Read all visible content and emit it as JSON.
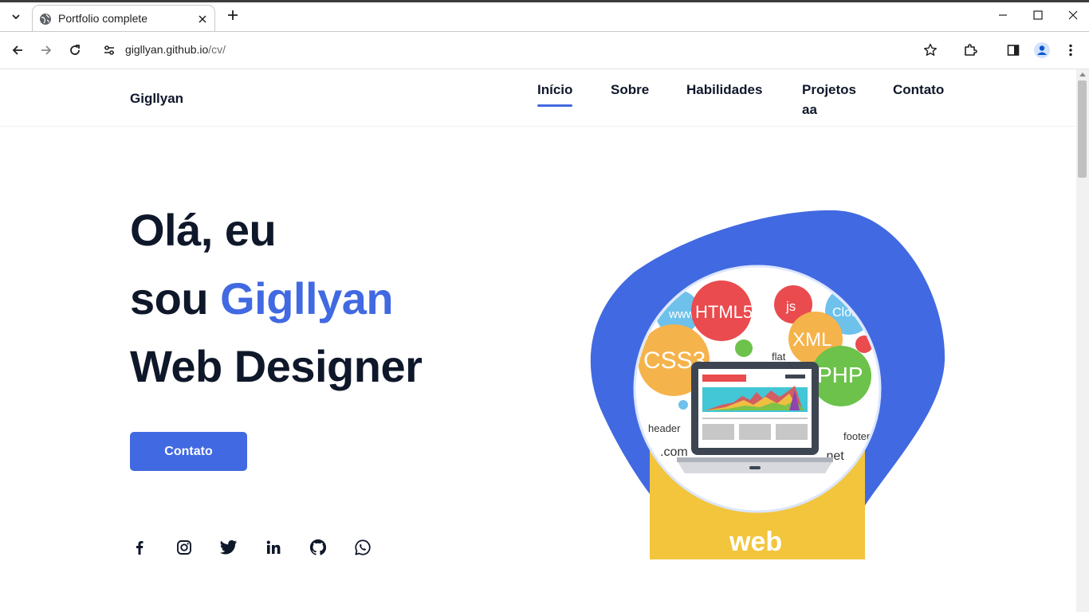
{
  "browser": {
    "tab_title": "Portfolio complete",
    "url_host": "gigllyan.github.io",
    "url_path": "/cv/"
  },
  "site": {
    "logo": "Gigllyan",
    "nav": [
      {
        "label": "Início",
        "active": true
      },
      {
        "label": "Sobre",
        "active": false
      },
      {
        "label": "Habilidades",
        "active": false
      },
      {
        "label": "Projetos",
        "label2": "aa",
        "active": false
      },
      {
        "label": "Contato",
        "active": false
      }
    ]
  },
  "hero": {
    "line1": "Olá, eu",
    "line2_prefix": "sou ",
    "line2_name": "Gigllyan",
    "line3": "Web Designer",
    "cta_label": "Contato"
  },
  "socials": [
    "facebook-icon",
    "instagram-icon",
    "twitter-icon",
    "linkedin-icon",
    "github-icon",
    "whatsapp-icon"
  ],
  "illustration": {
    "labels": [
      "www",
      "HTML5",
      "js",
      "Cloud",
      "XML",
      "CSS3",
      "flat",
      "PHP",
      "header",
      ".com",
      "footer",
      ".net",
      "web"
    ]
  },
  "colors": {
    "accent": "#4169e1",
    "heading": "#0f172a",
    "yellow": "#f2c53d"
  }
}
